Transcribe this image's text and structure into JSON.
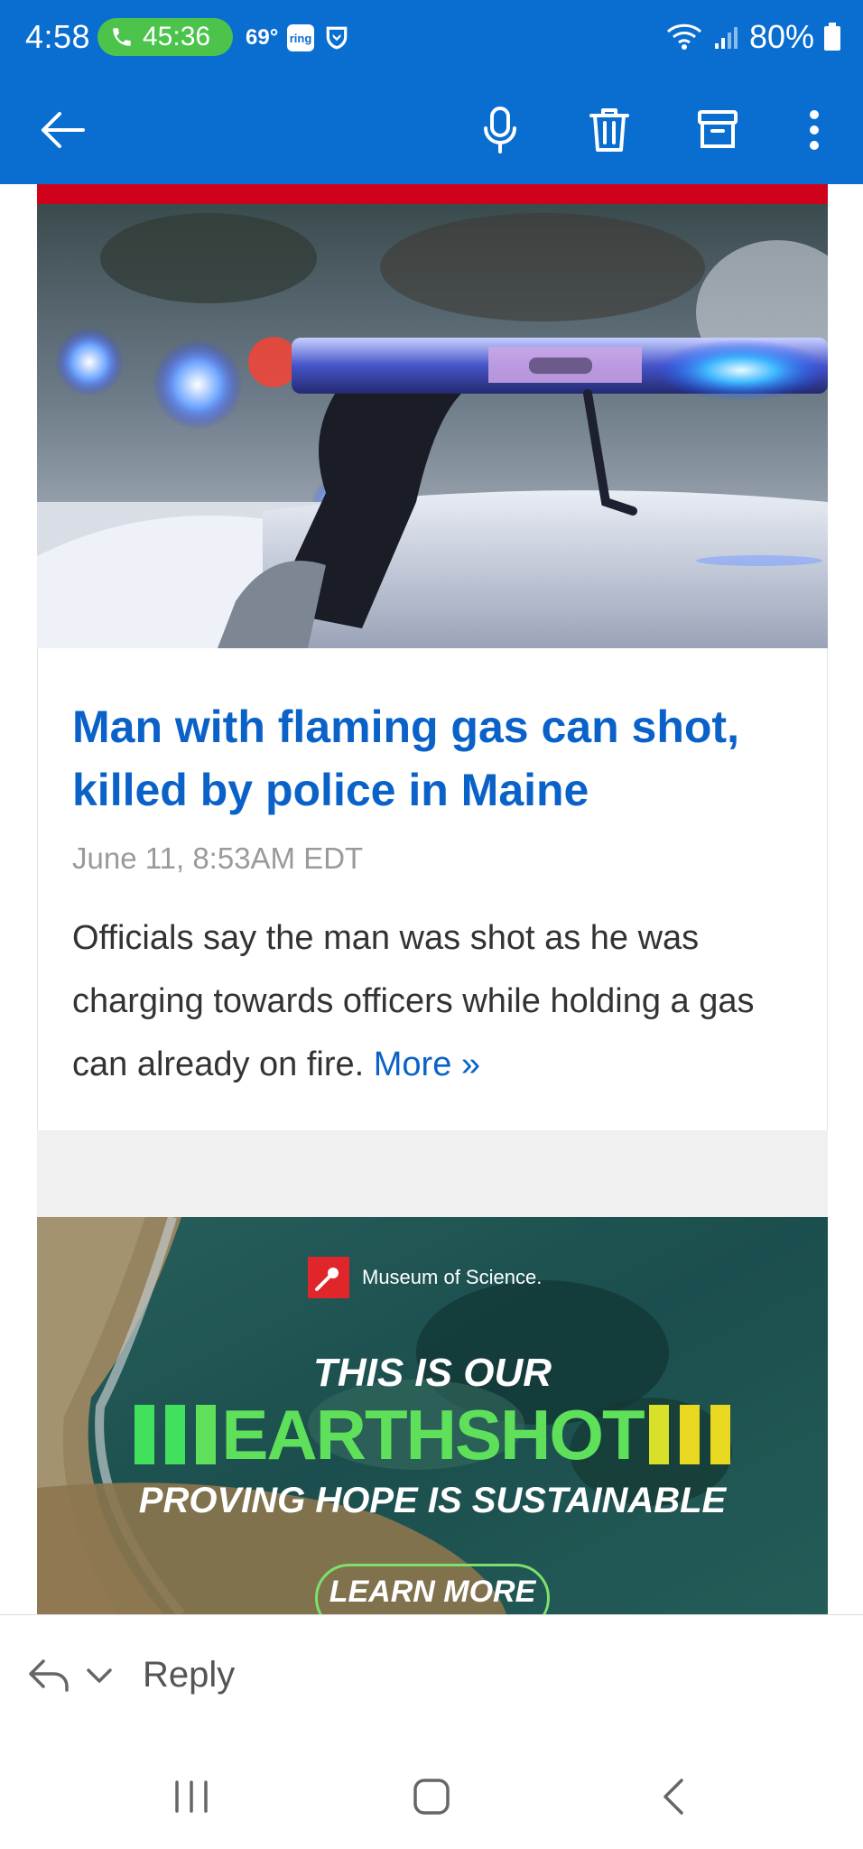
{
  "status_bar": {
    "time": "4:58",
    "call_timer": "45:36",
    "temperature": "69°",
    "ring_badge": "ring",
    "battery": "80%"
  },
  "toolbar": {
    "icons": [
      "back-arrow-icon",
      "microphone-icon",
      "trash-icon",
      "archive-icon",
      "more-vert-icon"
    ]
  },
  "article": {
    "headline": "Man with flaming gas can shot, killed by police in Maine",
    "date": "June 11, 8:53AM EDT",
    "summary": "Officials say the man was shot as he was charging towards officers while holding a gas can already on fire.",
    "more_link": "More »"
  },
  "ad": {
    "sponsor": "Museum of Science.",
    "line1": "THIS IS OUR",
    "line2": "EARTHSHOT",
    "line3": "PROVING HOPE IS SUSTAINABLE",
    "cta": "LEARN MORE"
  },
  "reply_bar": {
    "label": "Reply"
  },
  "colors": {
    "brand_blue": "#0a6ed1",
    "link_blue": "#0a62c9",
    "accent_red": "#d0021b",
    "call_green": "#4cc44c"
  }
}
